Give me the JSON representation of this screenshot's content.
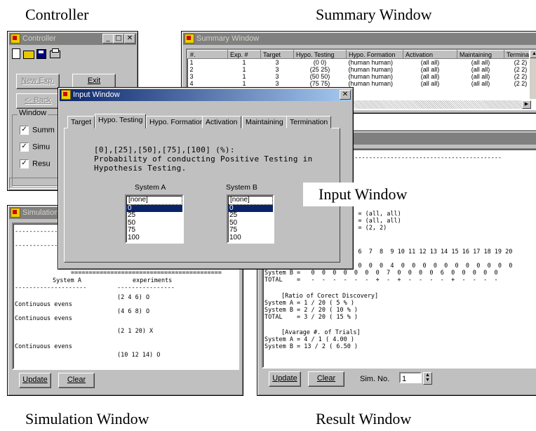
{
  "captions": {
    "controller": "Controller",
    "summary": "Summary Window",
    "input": "Input Window",
    "simulation": "Simulation Window",
    "result": "Result Window"
  },
  "controller": {
    "title": "Controller",
    "new_exp": "New Exp.",
    "exit": "Exit",
    "back": "<- Back",
    "group_label": "Window",
    "checkboxes": [
      "Summ",
      "Simu",
      "Resu"
    ]
  },
  "summary": {
    "title": "Summary Window",
    "columns": [
      "#.",
      "Exp. #",
      "Target",
      "Hypo. Testing",
      "Hypo. Formation",
      "Activation",
      "Maintaining",
      "Termina."
    ],
    "rows": [
      [
        "1",
        "1",
        "3",
        "(0 0)",
        "(human human)",
        "(all all)",
        "(all all)",
        "(2 2)"
      ],
      [
        "2",
        "1",
        "3",
        "(25 25)",
        "(human human)",
        "(all all)",
        "(all all)",
        "(2 2)"
      ],
      [
        "3",
        "1",
        "3",
        "(50 50)",
        "(human human)",
        "(all all)",
        "(all all)",
        "(2 2)"
      ],
      [
        "4",
        "1",
        "3",
        "(75 75)",
        "(human human)",
        "(all all)",
        "(all all)",
        "(2 2)"
      ]
    ]
  },
  "input": {
    "title": "Input Window",
    "tabs": [
      "Target",
      "Hypo. Testing",
      "Hypo. Formation",
      "Activation",
      "Maintaining",
      "Termination"
    ],
    "text1": "[0],[25],[50],[75],[100] (%):",
    "text2": "Probability of conducting Positive Testing in",
    "text3": "Hypothesis Testing.",
    "sysA_label": "System A",
    "sysB_label": "System B",
    "options": [
      "[none]",
      "0",
      "25",
      "50",
      "75",
      "100"
    ],
    "selected_option": "0"
  },
  "simulation": {
    "title": "Simulation",
    "dashes1": "------------------------------------------",
    "dashes2": "---------------------",
    "equals": "==========================================",
    "header_left": "System A",
    "header_right": "experiments",
    "dash_left": "--------------------",
    "dash_right": "----------------",
    "lines": [
      {
        "left": "",
        "right": "(2 4 6) O"
      },
      {
        "left": "Continuous evens",
        "right": ""
      },
      {
        "left": "",
        "right": "(4 6 8) O"
      },
      {
        "left": "Continuous evens",
        "right": ""
      },
      {
        "left": "",
        "right": "(2 1 20) X"
      },
      {
        "left": "Continuous evens",
        "right": ""
      },
      {
        "left": "",
        "right": "(10 12 14) O"
      }
    ],
    "update": "Update",
    "clear": "Clear"
  },
  "result": {
    "dashes": "-------------------------------------------",
    "params": [
      "B) = (all, all)",
      "B) = (all, all)",
      "B) = (2, 2)"
    ],
    "numbers_header": "5  6  7  8  9 10 11 12 13 14 15 16 17 18 19 20",
    "row_a": "0  0  0  0  4  0  0  0  0  0  0  0  0  0  0  0",
    "row_b": "System B =   0  0  0  0  0  0  0  7  0  0  0  0  6  0  0  0  0  0",
    "row_total": "TOTAL    =   -  -  -  -  -  -  +  -  +  -  -  -  -  +  -  -  -  -",
    "ratio_title": "[Ratio of Corect Discovery]",
    "ratio_a": "System A = 1 / 20 ( 5 % )",
    "ratio_b": "System B = 2 / 20 ( 10 % )",
    "ratio_total": "TOTAL    = 3 / 20 ( 15 % )",
    "avg_title": "[Avarage #. of Trials]",
    "avg_a": "System A = 4 / 1 ( 4.00 )",
    "avg_b": "System B = 13 / 2 ( 6.50 )",
    "update": "Update",
    "clear": "Clear",
    "sim_no_label": "Sim. No.",
    "sim_no_value": "1"
  }
}
